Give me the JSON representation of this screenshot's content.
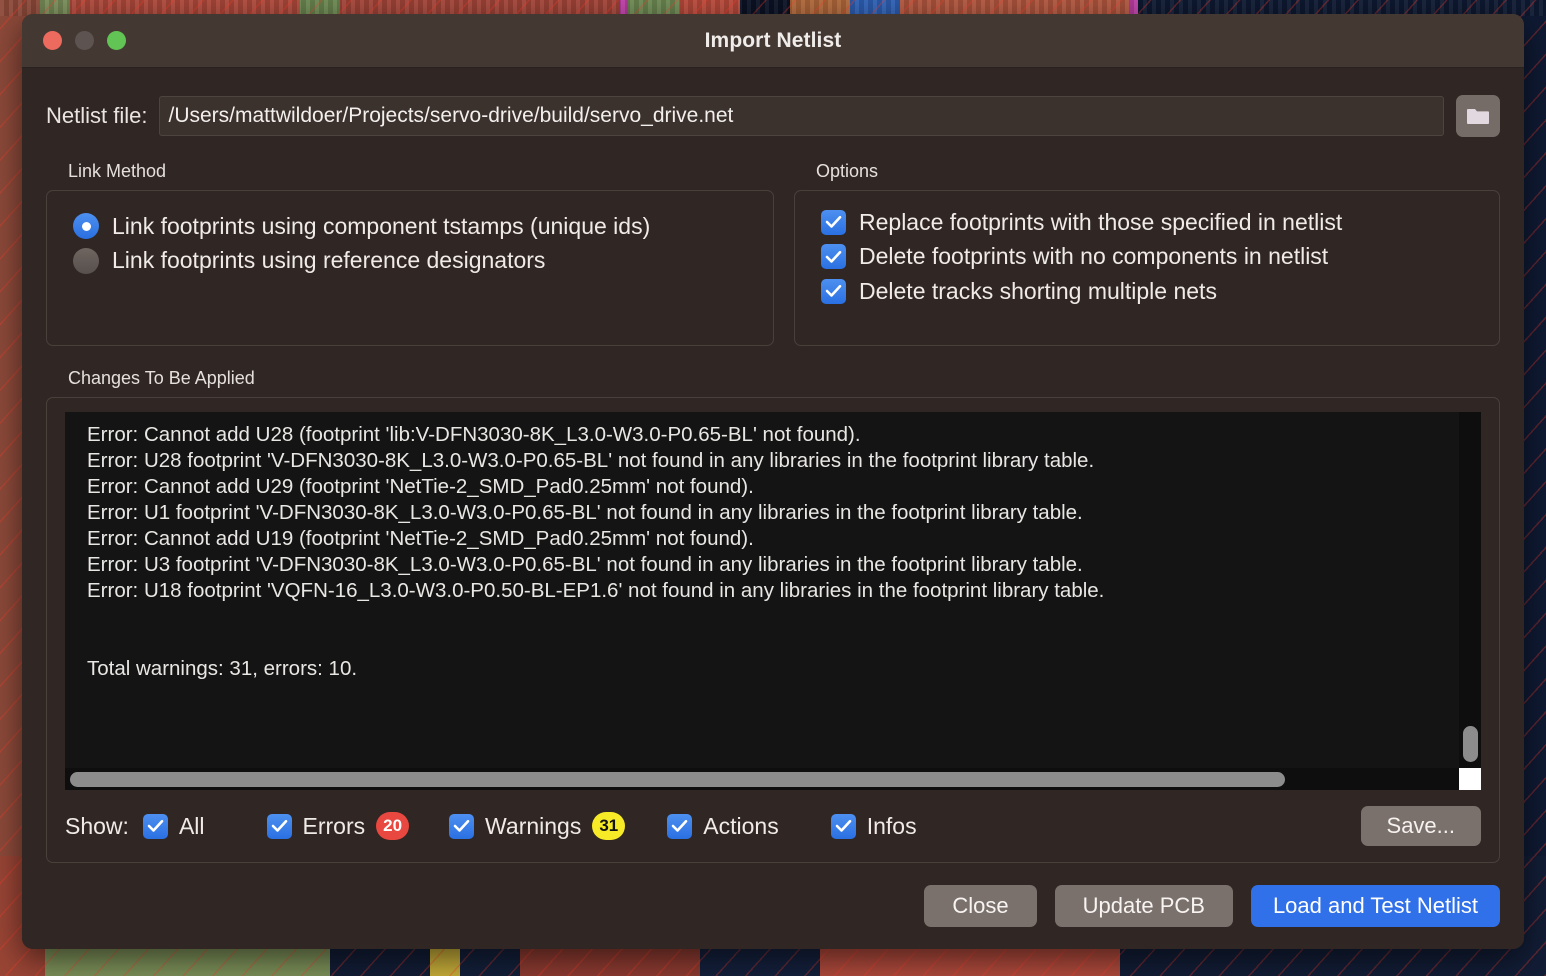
{
  "window": {
    "title": "Import Netlist",
    "traffic_lights": [
      "close",
      "minimize",
      "maximize"
    ]
  },
  "file_row": {
    "label": "Netlist file:",
    "value": "/Users/mattwildoer/Projects/servo-drive/build/servo_drive.net",
    "browse_icon": "folder-icon"
  },
  "link_method": {
    "title": "Link Method",
    "options": [
      {
        "label": "Link footprints using component tstamps (unique ids)",
        "checked": true
      },
      {
        "label": "Link footprints using reference designators",
        "checked": false
      }
    ]
  },
  "options": {
    "title": "Options",
    "items": [
      {
        "label": "Replace footprints with those specified in netlist",
        "checked": true
      },
      {
        "label": "Delete footprints with no components in netlist",
        "checked": true
      },
      {
        "label": "Delete tracks shorting multiple nets",
        "checked": true
      }
    ]
  },
  "changes": {
    "title": "Changes To Be Applied",
    "log_lines": [
      "Error: Cannot add U28 (footprint 'lib:V-DFN3030-8K_L3.0-W3.0-P0.65-BL' not found).",
      "Error: U28 footprint 'V-DFN3030-8K_L3.0-W3.0-P0.65-BL' not found in any libraries in the footprint library table.",
      "Error: Cannot add U29 (footprint 'NetTie-2_SMD_Pad0.25mm' not found).",
      "Error: U1 footprint 'V-DFN3030-8K_L3.0-W3.0-P0.65-BL' not found in any libraries in the footprint library table.",
      "Error: Cannot add U19 (footprint 'NetTie-2_SMD_Pad0.25mm' not found).",
      "Error: U3 footprint 'V-DFN3030-8K_L3.0-W3.0-P0.65-BL' not found in any libraries in the footprint library table.",
      "Error: U18 footprint 'VQFN-16_L3.0-W3.0-P0.50-BL-EP1.6' not found in any libraries in the footprint library table.",
      "",
      "Total warnings: 31, errors: 10."
    ],
    "log_text": "Error: Cannot add U28 (footprint 'lib:V-DFN3030-8K_L3.0-W3.0-P0.65-BL' not found).\nError: U28 footprint 'V-DFN3030-8K_L3.0-W3.0-P0.65-BL' not found in any libraries in the footprint library table.\nError: Cannot add U29 (footprint 'NetTie-2_SMD_Pad0.25mm' not found).\nError: U1 footprint 'V-DFN3030-8K_L3.0-W3.0-P0.65-BL' not found in any libraries in the footprint library table.\nError: Cannot add U19 (footprint 'NetTie-2_SMD_Pad0.25mm' not found).\nError: U3 footprint 'V-DFN3030-8K_L3.0-W3.0-P0.65-BL' not found in any libraries in the footprint library table.\nError: U18 footprint 'VQFN-16_L3.0-W3.0-P0.50-BL-EP1.6' not found in any libraries in the footprint library table.\n\n\nTotal warnings: 31, errors: 10.",
    "totals": {
      "warnings": 31,
      "errors": 10
    }
  },
  "show": {
    "label": "Show:",
    "filters": [
      {
        "name": "all",
        "label": "All",
        "checked": true,
        "badge": null,
        "badge_color": null
      },
      {
        "name": "errors",
        "label": "Errors",
        "checked": true,
        "badge": "20",
        "badge_color": "#e8483f"
      },
      {
        "name": "warnings",
        "label": "Warnings",
        "checked": true,
        "badge": "31",
        "badge_color": "#f7ea27"
      },
      {
        "name": "actions",
        "label": "Actions",
        "checked": true,
        "badge": null,
        "badge_color": null
      },
      {
        "name": "infos",
        "label": "Infos",
        "checked": true,
        "badge": null,
        "badge_color": null
      }
    ],
    "save_label": "Save..."
  },
  "footer": {
    "close_label": "Close",
    "update_label": "Update PCB",
    "load_label": "Load and Test Netlist",
    "primary_color": "#3070e8"
  }
}
